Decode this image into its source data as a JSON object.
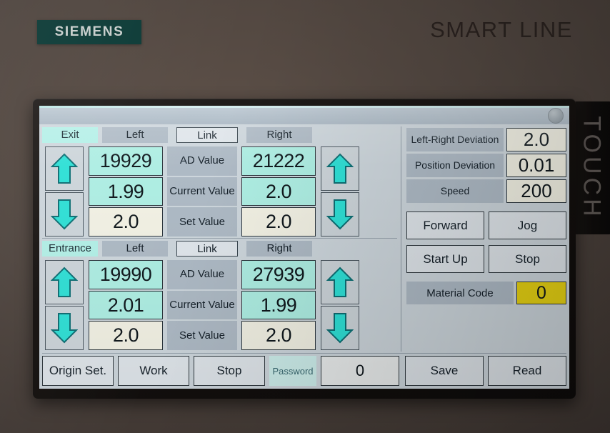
{
  "device": {
    "brand": "SIEMENS",
    "product_line": "SMART LINE",
    "side_text": "TOUCH"
  },
  "sections": [
    {
      "name": "Exit",
      "header": {
        "left": "Left",
        "link": "Link",
        "right": "Right"
      },
      "rows": [
        {
          "label": "AD Value",
          "left": "19929",
          "right": "21222"
        },
        {
          "label": "Current Value",
          "left": "1.99",
          "right": "2.0"
        },
        {
          "label": "Set Value",
          "left": "2.0",
          "right": "2.0"
        }
      ],
      "arrows": {
        "up": "up-arrow",
        "down": "down-arrow"
      }
    },
    {
      "name": "Entrance",
      "header": {
        "left": "Left",
        "link": "Link",
        "right": "Right"
      },
      "rows": [
        {
          "label": "AD Value",
          "left": "19990",
          "right": "27939"
        },
        {
          "label": "Current Value",
          "left": "2.01",
          "right": "1.99"
        },
        {
          "label": "Set Value",
          "left": "2.0",
          "right": "2.0"
        }
      ],
      "arrows": {
        "up": "up-arrow",
        "down": "down-arrow"
      }
    }
  ],
  "right_panel": {
    "readouts": [
      {
        "label": "Left-Right Deviation",
        "value": "2.0"
      },
      {
        "label": "Position Deviation",
        "value": "0.01"
      },
      {
        "label": "Speed",
        "value": "200"
      }
    ],
    "buttons": [
      "Forward",
      "Jog",
      "Start Up",
      "Stop"
    ],
    "material_code": {
      "label": "Material Code",
      "value": "0"
    }
  },
  "bottom_bar": {
    "origin_set": "Origin Set.",
    "work": "Work",
    "stop": "Stop",
    "password_label": "Password",
    "password_value": "0",
    "save": "Save",
    "read": "Read"
  },
  "colors": {
    "accent_cyan": "#aeeee3",
    "label_blue_gray": "#aebac5",
    "cream_field": "#f2f1e4",
    "material_yellow": "#e8d313",
    "siemens_teal": "#0d3b37",
    "arrow_cyan": "#2fe0d6"
  }
}
